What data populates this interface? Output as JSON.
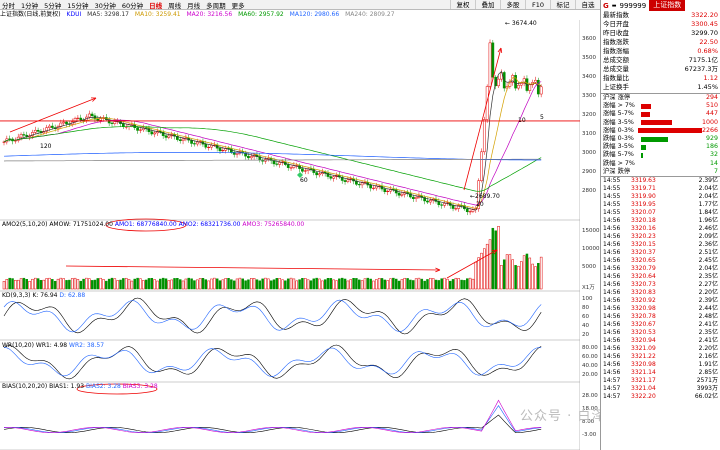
{
  "toolbar": {
    "periods": [
      "分时",
      "1分钟",
      "5分钟",
      "15分钟",
      "30分钟",
      "60分钟",
      "日线",
      "周线",
      "月线",
      "多周期",
      "更多"
    ],
    "active": "日线",
    "right_buttons": [
      "复权",
      "叠加",
      "多股",
      "F10",
      "标记",
      "自选"
    ]
  },
  "infoline": {
    "name": "上证指数(日线,前复权)",
    "kdui": "KDUI",
    "ma5": "MA5: 3298.17",
    "ma10": "MA10: 3259.41",
    "ma20": "MA20: 3216.56",
    "ma60": "MA60: 2957.92",
    "ma120": "MA120: 2980.66",
    "ma240": "MA240: 2809.27"
  },
  "panel": {
    "code": "999999",
    "name": "上证指数",
    "stats": [
      {
        "k": "最新指数",
        "v": "3322.20",
        "c": "red"
      },
      {
        "k": "今日开盘",
        "v": "3300.45",
        "c": "red"
      },
      {
        "k": "昨日收盘",
        "v": "3299.70",
        "c": "blk"
      },
      {
        "k": "指数涨跌",
        "v": "22.50",
        "c": "red"
      },
      {
        "k": "指数涨幅",
        "v": "0.68%",
        "c": "red"
      },
      {
        "k": "总成交额",
        "v": "7175.1亿",
        "c": "blk"
      },
      {
        "k": "总成交量",
        "v": "67237.3万",
        "c": "blk"
      },
      {
        "k": "指数量比",
        "v": "1.12",
        "c": "red"
      },
      {
        "k": "上证换手",
        "v": "1.45%",
        "c": "blk"
      }
    ],
    "breadth": [
      {
        "l": "沪深 涨停",
        "n": "294",
        "c": "#d00",
        "w": 0
      },
      {
        "l": "涨幅 > 7%",
        "n": "510",
        "c": "#d00",
        "w": 6
      },
      {
        "l": "涨幅 5-7%",
        "n": "447",
        "c": "#d00",
        "w": 5
      },
      {
        "l": "涨幅 3-5%",
        "n": "1000",
        "c": "#d00",
        "w": 18
      },
      {
        "l": "涨幅 0-3%",
        "n": "2266",
        "c": "#d00",
        "w": 40
      },
      {
        "l": "跌幅 0-3%",
        "n": "929",
        "c": "#090",
        "w": 16
      },
      {
        "l": "跌幅 3-5%",
        "n": "186",
        "c": "#090",
        "w": 3
      },
      {
        "l": "跌幅 5-7%",
        "n": "32",
        "c": "#090",
        "w": 1
      },
      {
        "l": "跌幅 > 7%",
        "n": "14",
        "c": "#090",
        "w": 0
      },
      {
        "l": "沪深 跌停",
        "n": "7",
        "c": "#090",
        "w": 0
      }
    ],
    "ticks": [
      {
        "t": "14:55",
        "p": "3319.63",
        "v": "2.39亿"
      },
      {
        "t": "14:55",
        "p": "3319.71",
        "v": "2.04亿"
      },
      {
        "t": "14:55",
        "p": "3319.90",
        "v": "2.04亿"
      },
      {
        "t": "14:55",
        "p": "3319.95",
        "v": "1.77亿"
      },
      {
        "t": "14:55",
        "p": "3320.07",
        "v": "1.84亿"
      },
      {
        "t": "14:56",
        "p": "3320.18",
        "v": "1.96亿"
      },
      {
        "t": "14:56",
        "p": "3320.16",
        "v": "2.46亿"
      },
      {
        "t": "14:56",
        "p": "3320.23",
        "v": "2.09亿"
      },
      {
        "t": "14:56",
        "p": "3320.15",
        "v": "2.36亿"
      },
      {
        "t": "14:56",
        "p": "3320.37",
        "v": "2.51亿"
      },
      {
        "t": "14:56",
        "p": "3320.65",
        "v": "2.45亿"
      },
      {
        "t": "14:56",
        "p": "3320.79",
        "v": "2.04亿"
      },
      {
        "t": "14:56",
        "p": "3320.64",
        "v": "2.35亿"
      },
      {
        "t": "14:56",
        "p": "3320.73",
        "v": "2.27亿"
      },
      {
        "t": "14:56",
        "p": "3320.83",
        "v": "2.20亿"
      },
      {
        "t": "14:56",
        "p": "3320.92",
        "v": "2.39亿"
      },
      {
        "t": "14:56",
        "p": "3320.98",
        "v": "2.44亿"
      },
      {
        "t": "14:56",
        "p": "3320.78",
        "v": "2.48亿"
      },
      {
        "t": "14:56",
        "p": "3320.67",
        "v": "2.41亿"
      },
      {
        "t": "14:56",
        "p": "3320.53",
        "v": "2.35亿"
      },
      {
        "t": "14:56",
        "p": "3320.94",
        "v": "2.41亿"
      },
      {
        "t": "14:56",
        "p": "3321.09",
        "v": "2.20亿"
      },
      {
        "t": "14:56",
        "p": "3321.22",
        "v": "2.16亿"
      },
      {
        "t": "14:56",
        "p": "3320.98",
        "v": "1.91亿"
      },
      {
        "t": "14:56",
        "p": "3321.14",
        "v": "2.85亿"
      },
      {
        "t": "14:57",
        "p": "3321.17",
        "v": "2571万"
      },
      {
        "t": "14:57",
        "p": "3321.04",
        "v": "3993万"
      },
      {
        "t": "14:57",
        "p": "3322.20",
        "v": "66.02亿"
      }
    ]
  },
  "price_axis": [
    "3600",
    "3500",
    "3400",
    "3300",
    "3200",
    "3100",
    "3000",
    "2900",
    "2800"
  ],
  "annotations": {
    "high": "3674.40",
    "low": "2689.70",
    "m120": "120",
    "m60": "60",
    "m20": "20",
    "m10": "10",
    "m5": "5"
  },
  "amo": {
    "title": "AMO2(5,10,20)",
    "amow": "AMOW: 71751024.00",
    "amo1": "AMO1: 68776840.00",
    "amo2": "AMO2: 68321736.00",
    "amo3": "AMO3: 75265840.00",
    "axis": [
      "15000",
      "10000",
      "5000"
    ],
    "unit": "X1万"
  },
  "kd": {
    "title": "KD(9,3,3)",
    "k": "K: 76.94",
    "d": "D: 62.88",
    "axis": [
      "100",
      "80",
      "60",
      "40",
      "20"
    ]
  },
  "wr": {
    "title": "WR(10,20)",
    "wr1": "WR1: 4.98",
    "wr2": "WR2: 38.57",
    "axis": [
      "80.00",
      "60.00",
      "40.00",
      "20.00"
    ]
  },
  "bias": {
    "title": "BIAS(10,20,20)",
    "b1": "BIAS1: 1.93",
    "b2": "BIAS2: 3.28",
    "b3": "BIAS3: 3.28",
    "axis": [
      "28.00",
      "18.00",
      "8.00",
      "-3.00"
    ]
  },
  "watermark": "公众号 · 白泽胖",
  "colors": {
    "up": "#e00000",
    "down": "#009000",
    "ma5": "#333333",
    "ma10": "#d4a000",
    "ma20": "#c000c0",
    "ma60": "#00a000",
    "ma120": "#2060ff",
    "ma240": "#808080"
  }
}
